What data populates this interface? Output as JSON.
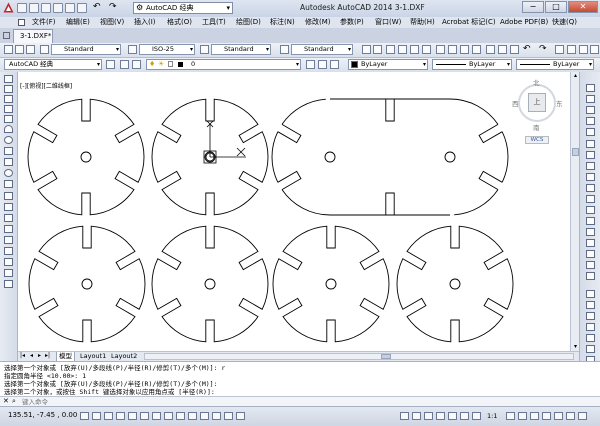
{
  "title_bar": {
    "title": "Autodesk AutoCAD 2014    3-1.DXF",
    "workspace": "AutoCAD 经典",
    "window_buttons": [
      "−",
      "□",
      "✕"
    ]
  },
  "menu": [
    "文件(F)",
    "编辑(E)",
    "视图(V)",
    "插入(I)",
    "格式(O)",
    "工具(T)",
    "绘图(D)",
    "标注(N)",
    "修改(M)",
    "参数(P)",
    "窗口(W)",
    "帮助(H)",
    "Acrobat 标记(C)",
    "Adobe PDF(B)",
    "快速(Q)"
  ],
  "doc_tab": "3-1.DXF*",
  "styles_toolbar": {
    "text_style": "Standard",
    "dim_style": "ISO-25",
    "table_style": "Standard",
    "mleader_style": "Standard"
  },
  "layers_toolbar": {
    "workspace": "AutoCAD 经典",
    "layer": "0",
    "color": "ByLayer",
    "linetype": "ByLayer",
    "lineweight": "ByLayer"
  },
  "viewport_label": "[-][俯视][二维线框]",
  "viewcube": {
    "north": "北",
    "south": "南",
    "east": "东",
    "west": "西",
    "top": "上",
    "wcs": "WCS"
  },
  "layout_tabs": [
    "模型",
    "Layout1",
    "Layout2"
  ],
  "command_history": [
    "选择第一个对象或 [放弃(U)/多段线(P)/半径(R)/修剪(T)/多个(M)]: r",
    "指定圆角半径 <10.00>: 1",
    "选择第一个对象或 [放弃(U)/多段线(P)/半径(R)/修剪(T)/多个(M)]:",
    "选择第二个对象，或按住 Shift 键选择对象以应用角点或 [半径(R)]:"
  ],
  "command_placeholder": "键入命令",
  "status": {
    "coordinates": "135.51, -7.45 , 0.00",
    "scale": "1:1"
  },
  "colors": {
    "canvas": "#ffffff",
    "linework": "#000000",
    "chrome": "#d6dbe9"
  }
}
